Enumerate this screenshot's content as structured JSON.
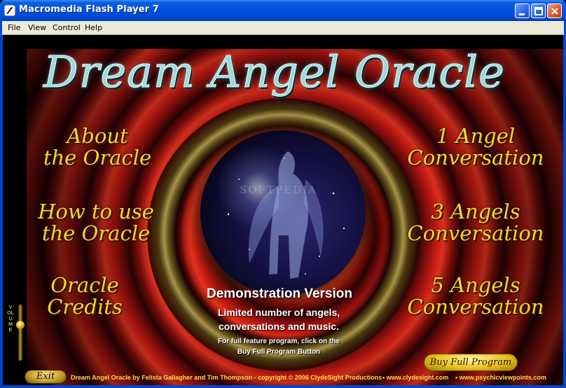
{
  "window": {
    "title": "Macromedia Flash Player 7",
    "menu": [
      "File",
      "View",
      "Control",
      "Help"
    ]
  },
  "app": {
    "title": "Dream Angel Oracle",
    "watermark": "SOFTPEDIA",
    "left_menu": [
      "About\nthe Oracle",
      "How to use\nthe Oracle",
      "Oracle\nCredits"
    ],
    "right_menu": [
      "1 Angel\nConversation",
      "3 Angels\nConversation",
      "5 Angels\nConversation"
    ],
    "demo": {
      "title": "Demonstration Version",
      "line1": "Limited number of angels,",
      "line2": "conversations and music.",
      "small1": "For full feature program, click on the",
      "small2": "Buy Full Program Button"
    },
    "volume_label": "VOLUME",
    "buy_button": "Buy Full Program",
    "exit_button": "Exit",
    "footer": {
      "credit": "Dream Angel Oracle by Felista Gallagher and Tim Thompson - copyright  © 2006 ClydeSight Productions",
      "site1": "•  www.clydesight.com",
      "site2": "•  www.psychicviewpoints.com"
    }
  },
  "colors": {
    "titlebar": "#0052de",
    "menu_bg": "#ece9d8",
    "gold_text": "#f3d43a",
    "title_text": "#9fd8d8"
  }
}
